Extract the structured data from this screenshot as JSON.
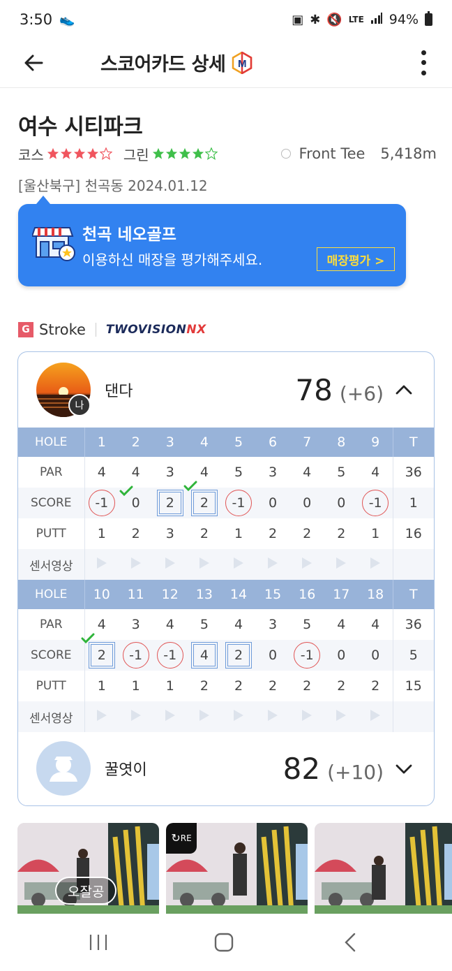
{
  "status_bar": {
    "time": "3:50",
    "network": "LTE",
    "battery": "94%"
  },
  "app_bar": {
    "title": "스코어카드 상세",
    "back_icon": "arrow-left-icon",
    "menu_icon": "more-vert-icon"
  },
  "course": {
    "name": "여수 시티파크",
    "course_label": "코스",
    "course_rating": 4,
    "green_label": "그린",
    "green_rating": 4,
    "tee": "Front Tee",
    "distance": "5,418m",
    "location": "[울산북구] 천곡동 2024.01.12"
  },
  "banner": {
    "store_name": "천곡 네오골프",
    "message": "이용하신 매장을 평가해주세요.",
    "button_label": "매장평가 >"
  },
  "game": {
    "badge": "G",
    "type": "Stroke",
    "system_brand_a": "TWOVISION",
    "system_brand_b": "NX"
  },
  "labels": {
    "hole": "HOLE",
    "par": "PAR",
    "score": "SCORE",
    "putt": "PUTT",
    "sensor": "센서영상",
    "total": "T"
  },
  "players": [
    {
      "name": "댄다",
      "me_badge": "나",
      "total": "78",
      "diff": "(+6)",
      "expanded": true
    },
    {
      "name": "꿀엿이",
      "total": "82",
      "diff": "(+10)",
      "expanded": false
    }
  ],
  "front_nine": {
    "holes": [
      "1",
      "2",
      "3",
      "4",
      "5",
      "6",
      "7",
      "8",
      "9"
    ],
    "par": [
      "4",
      "4",
      "3",
      "4",
      "5",
      "3",
      "4",
      "5",
      "4"
    ],
    "par_total": "36",
    "score": [
      {
        "v": "-1",
        "mark": "circle",
        "check": false
      },
      {
        "v": "0",
        "mark": "none",
        "check": true
      },
      {
        "v": "2",
        "mark": "square",
        "check": false
      },
      {
        "v": "2",
        "mark": "square",
        "check": true
      },
      {
        "v": "-1",
        "mark": "circle",
        "check": false
      },
      {
        "v": "0",
        "mark": "none",
        "check": false
      },
      {
        "v": "0",
        "mark": "none",
        "check": false
      },
      {
        "v": "0",
        "mark": "none",
        "check": false
      },
      {
        "v": "-1",
        "mark": "circle",
        "check": false
      }
    ],
    "score_total": "1",
    "putt": [
      "1",
      "2",
      "3",
      "2",
      "1",
      "2",
      "2",
      "2",
      "1"
    ],
    "putt_total": "16"
  },
  "back_nine": {
    "holes": [
      "10",
      "11",
      "12",
      "13",
      "14",
      "15",
      "16",
      "17",
      "18"
    ],
    "par": [
      "4",
      "3",
      "4",
      "5",
      "4",
      "3",
      "5",
      "4",
      "4"
    ],
    "par_total": "36",
    "score": [
      {
        "v": "2",
        "mark": "square",
        "check": true
      },
      {
        "v": "-1",
        "mark": "circle",
        "check": false
      },
      {
        "v": "-1",
        "mark": "circle",
        "check": false
      },
      {
        "v": "4",
        "mark": "square",
        "check": false
      },
      {
        "v": "2",
        "mark": "square",
        "check": false
      },
      {
        "v": "0",
        "mark": "none",
        "check": false
      },
      {
        "v": "-1",
        "mark": "circle",
        "check": false
      },
      {
        "v": "0",
        "mark": "none",
        "check": false
      },
      {
        "v": "0",
        "mark": "none",
        "check": false
      }
    ],
    "score_total": "5",
    "putt": [
      "1",
      "1",
      "1",
      "2",
      "2",
      "2",
      "2",
      "2",
      "2"
    ],
    "putt_total": "15"
  },
  "thumbnails": [
    {
      "label": "오잘공",
      "badge": ""
    },
    {
      "label": "",
      "badge": "RE"
    },
    {
      "label": "",
      "badge": ""
    }
  ],
  "colors": {
    "accent_blue": "#3282f0",
    "header_blue": "#98b3d9",
    "star_red": "#f0555e",
    "star_green": "#3fbf4a",
    "circle_red": "#e05555"
  }
}
